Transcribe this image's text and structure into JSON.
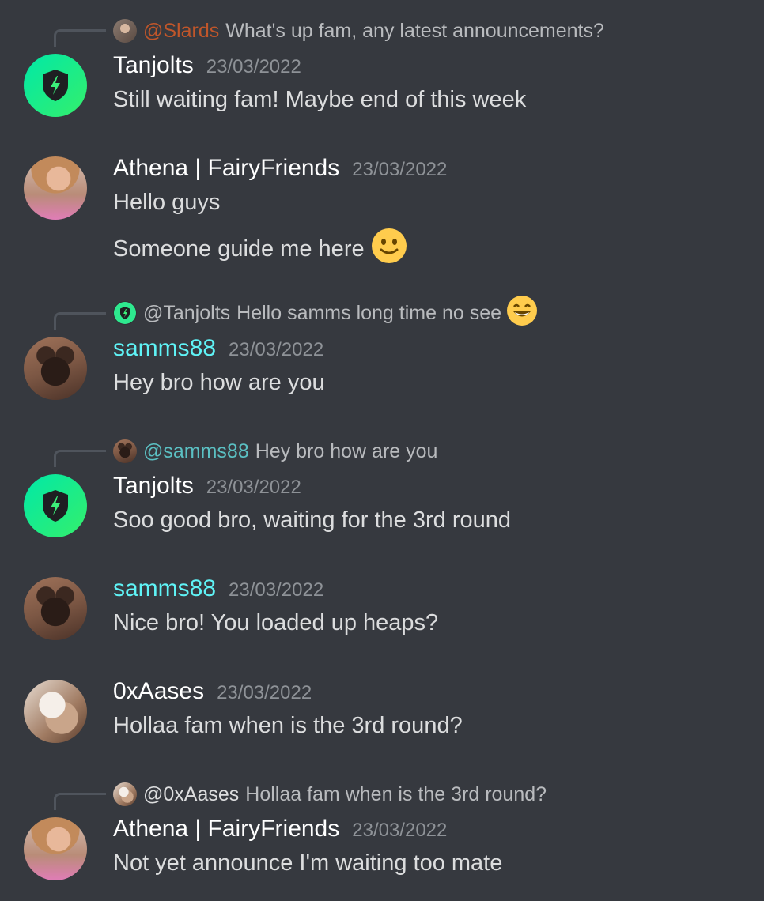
{
  "colors": {
    "background": "#36393f",
    "username_default": "#ffffff",
    "username_samms": "#5ff3f6",
    "mention_slards": "#c0562a",
    "mention_tanjolts": "#b9bbbe",
    "mention_samms": "#5bc0c3",
    "mention_0xaases": "#dcddde",
    "timestamp": "#8e9297"
  },
  "messages": [
    {
      "reply": {
        "user": "@Slards",
        "text": "What's up fam, any latest announcements?",
        "avatar_icon": "slards-avatar-icon"
      },
      "author": "Tanjolts",
      "timestamp": "23/03/2022",
      "avatar_icon": "shield-lightning-icon",
      "lines": [
        "Still waiting fam! Maybe end of this week"
      ]
    },
    {
      "author": "Athena | FairyFriends",
      "timestamp": "23/03/2022",
      "avatar_icon": "athena-avatar-icon",
      "lines": [
        "Hello guys",
        "Someone guide me here"
      ],
      "emoji": "slightly-smiling-face-icon"
    },
    {
      "reply": {
        "user": "@Tanjolts",
        "text": "Hello samms long time no see",
        "avatar_icon": "shield-lightning-icon",
        "emoji": "grinning-face-icon"
      },
      "author": "samms88",
      "timestamp": "23/03/2022",
      "avatar_icon": "cat-avatar-icon",
      "lines": [
        "Hey bro how are you"
      ]
    },
    {
      "reply": {
        "user": "@samms88",
        "text": "Hey bro how are you",
        "avatar_icon": "cat-avatar-icon"
      },
      "author": "Tanjolts",
      "timestamp": "23/03/2022",
      "avatar_icon": "shield-lightning-icon",
      "lines": [
        "Soo good bro, waiting for the 3rd round"
      ]
    },
    {
      "author": "samms88",
      "timestamp": "23/03/2022",
      "avatar_icon": "cat-avatar-icon",
      "lines": [
        "Nice bro! You loaded up heaps?"
      ]
    },
    {
      "author": "0xAases",
      "timestamp": "23/03/2022",
      "avatar_icon": "dog-avatar-icon",
      "lines": [
        "Hollaa fam when is the 3rd round?"
      ]
    },
    {
      "reply": {
        "user": "@0xAases",
        "text": "Hollaa fam when is the 3rd round?",
        "avatar_icon": "dog-avatar-icon"
      },
      "author": "Athena | FairyFriends",
      "timestamp": "23/03/2022",
      "avatar_icon": "athena-avatar-icon",
      "lines": [
        "Not yet announce I'm waiting too mate"
      ]
    }
  ]
}
